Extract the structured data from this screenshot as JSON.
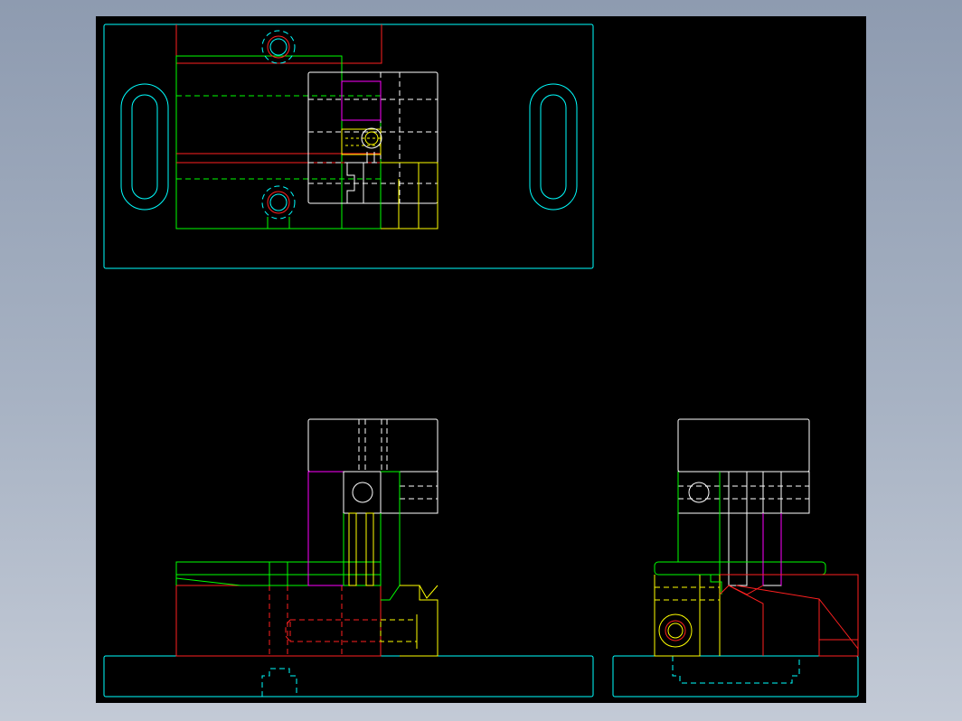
{
  "drawing": {
    "background": "#000000",
    "window_background": "#9aa5b8",
    "layer_colors": {
      "outline": "#00ffff",
      "parts_red": "#ff2020",
      "parts_green": "#00ff00",
      "block_white": "#ffffff",
      "detail_yellow": "#ffff00",
      "insert_magenta": "#ff00ff"
    },
    "views": [
      {
        "id": "top",
        "kind": "top view"
      },
      {
        "id": "front",
        "kind": "front view"
      },
      {
        "id": "side",
        "kind": "side view"
      }
    ]
  }
}
